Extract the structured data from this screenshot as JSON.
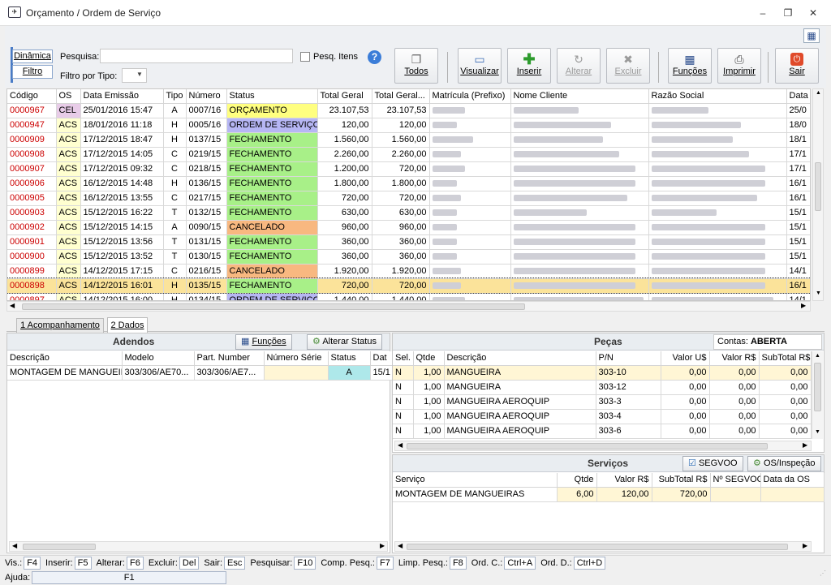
{
  "window": {
    "title": "Orçamento / Ordem de Serviço"
  },
  "toolbar": {
    "side_buttons": [
      "Dinâmica",
      "Filtro"
    ],
    "search_label": "Pesquisa:",
    "search_value": "",
    "search_placeholder": "",
    "pesq_itens_label": "Pesq. Itens",
    "filtro_tipo_label": "Filtro por Tipo:",
    "buttons": {
      "todos": "Todos",
      "visualizar": "Visualizar",
      "inserir": "Inserir",
      "alterar": "Alterar",
      "excluir": "Excluir",
      "funcoes": "Funções",
      "imprimir": "Imprimir",
      "sair": "Sair"
    }
  },
  "colors": {
    "red_code": "#cc0000",
    "orcamento": "#ffff80",
    "ordem": "#b6b6f4",
    "fechamento": "#a8f088",
    "cancelado": "#f8b880",
    "os_col": "#ffffd0",
    "cel": "#e8cce8",
    "selected": "#fbe39a"
  },
  "main_grid": {
    "columns": [
      "Código",
      "OS",
      "Data Emissão",
      "Tipo",
      "Número",
      "Status",
      "Total Geral",
      "Total Geral...",
      "Matrícula (Prefixo)",
      "Nome Cliente",
      "Razão Social",
      "Data"
    ],
    "rows": [
      [
        "0000967",
        "CEL",
        "25/01/2016 15:47",
        "A",
        "0007/16",
        "ORÇAMENTO",
        "23.107,53",
        "23.107,53",
        "25/0"
      ],
      [
        "0000947",
        "ACS",
        "18/01/2016 11:18",
        "H",
        "0005/16",
        "ORDEM DE SERVIÇO",
        "120,00",
        "120,00",
        "18/0"
      ],
      [
        "0000909",
        "ACS",
        "17/12/2015 18:47",
        "H",
        "0137/15",
        "FECHAMENTO",
        "1.560,00",
        "1.560,00",
        "18/1"
      ],
      [
        "0000908",
        "ACS",
        "17/12/2015 14:05",
        "C",
        "0219/15",
        "FECHAMENTO",
        "2.260,00",
        "2.260,00",
        "17/1"
      ],
      [
        "0000907",
        "ACS",
        "17/12/2015 09:32",
        "C",
        "0218/15",
        "FECHAMENTO",
        "1.200,00",
        "720,00",
        "17/1"
      ],
      [
        "0000906",
        "ACS",
        "16/12/2015 14:48",
        "H",
        "0136/15",
        "FECHAMENTO",
        "1.800,00",
        "1.800,00",
        "16/1"
      ],
      [
        "0000905",
        "ACS",
        "16/12/2015 13:55",
        "C",
        "0217/15",
        "FECHAMENTO",
        "720,00",
        "720,00",
        "16/1"
      ],
      [
        "0000903",
        "ACS",
        "15/12/2015 16:22",
        "T",
        "0132/15",
        "FECHAMENTO",
        "630,00",
        "630,00",
        "15/1"
      ],
      [
        "0000902",
        "ACS",
        "15/12/2015 14:15",
        "A",
        "0090/15",
        "CANCELADO",
        "960,00",
        "960,00",
        "15/1"
      ],
      [
        "0000901",
        "ACS",
        "15/12/2015 13:56",
        "T",
        "0131/15",
        "FECHAMENTO",
        "360,00",
        "360,00",
        "15/1"
      ],
      [
        "0000900",
        "ACS",
        "15/12/2015 13:52",
        "T",
        "0130/15",
        "FECHAMENTO",
        "360,00",
        "360,00",
        "15/1"
      ],
      [
        "0000899",
        "ACS",
        "14/12/2015 17:15",
        "C",
        "0216/15",
        "CANCELADO",
        "1.920,00",
        "1.920,00",
        "14/1"
      ],
      [
        "0000898",
        "ACS",
        "14/12/2015 16:01",
        "H",
        "0135/15",
        "FECHAMENTO",
        "720,00",
        "720,00",
        "16/1"
      ],
      [
        "0000897",
        "ACS",
        "14/12/2015 16:00",
        "H",
        "0134/15",
        "ORDEM DE SERVIÇO",
        "1.440,00",
        "1.440,00",
        "14/1"
      ]
    ]
  },
  "tabs": [
    "1 Acompanhamento",
    "2 Dados"
  ],
  "adendos": {
    "title": "Adendos",
    "funcoes": "Funções",
    "alterar_status": "Alterar Status",
    "columns": [
      "Descrição",
      "Modelo",
      "Part. Number",
      "Número Série",
      "Status",
      "Dat"
    ],
    "row": [
      "MONTAGEM DE MANGUEIRA",
      "303/306/AE70...",
      "303/306/AE7...",
      "",
      "A",
      "15/1"
    ]
  },
  "pecas": {
    "title": "Peças",
    "contas_label": "Contas:",
    "contas_value": "ABERTA",
    "columns": [
      "Sel.",
      "Qtde",
      "Descrição",
      "P/N",
      "Valor U$",
      "Valor R$",
      "SubTotal R$"
    ],
    "rows": [
      [
        "N",
        "1,00",
        "MANGUEIRA",
        "303-10",
        "0,00",
        "0,00",
        "0,00"
      ],
      [
        "N",
        "1,00",
        "MANGUEIRA",
        "303-12",
        "0,00",
        "0,00",
        "0,00"
      ],
      [
        "N",
        "1,00",
        "MANGUEIRA AEROQUIP",
        "303-3",
        "0,00",
        "0,00",
        "0,00"
      ],
      [
        "N",
        "1,00",
        "MANGUEIRA AEROQUIP",
        "303-4",
        "0,00",
        "0,00",
        "0,00"
      ],
      [
        "N",
        "1,00",
        "MANGUEIRA AEROQUIP",
        "303-6",
        "0,00",
        "0,00",
        "0,00"
      ]
    ]
  },
  "servicos": {
    "title": "Serviços",
    "segvoo": "SEGVOO",
    "os_inspecao": "OS/Inspeção",
    "columns": [
      "Serviço",
      "Qtde",
      "Valor R$",
      "SubTotal R$",
      "Nº SEGVOO",
      "Data da OS"
    ],
    "row": [
      "MONTAGEM DE MANGUEIRAS",
      "6,00",
      "120,00",
      "720,00",
      "",
      ""
    ]
  },
  "statusbar": [
    [
      "Vis.:",
      "F4"
    ],
    [
      "Inserir:",
      "F5"
    ],
    [
      "Alterar:",
      "F6"
    ],
    [
      "Excluir:",
      "Del"
    ],
    [
      "Sair:",
      "Esc"
    ],
    [
      "Pesquisar:",
      "F10"
    ],
    [
      "Comp. Pesq.:",
      "F7"
    ],
    [
      "Limp. Pesq.:",
      "F8"
    ],
    [
      "Ord. C.:",
      "Ctrl+A"
    ],
    [
      "Ord. D.:",
      "Ctrl+D"
    ],
    [
      "Ajuda:",
      "F1"
    ]
  ]
}
